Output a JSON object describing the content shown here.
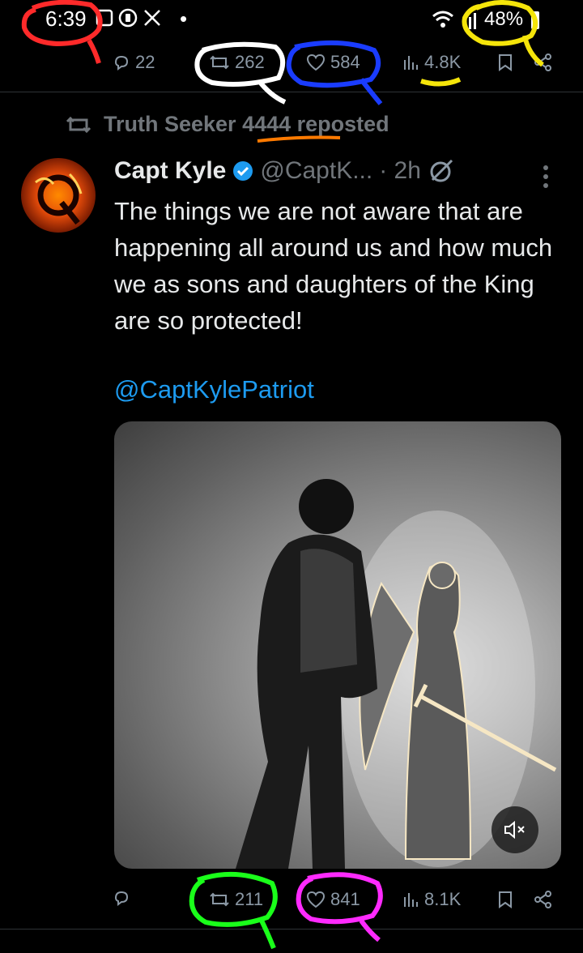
{
  "status_bar": {
    "time": "6:39",
    "notification_dot": "•",
    "battery": "48%"
  },
  "top_actions": {
    "replies": "22",
    "reposts": "262",
    "likes": "584",
    "views": "4.8K"
  },
  "repost_header": {
    "text": "Truth Seeker 4444 reposted"
  },
  "tweet": {
    "author_name": "Capt Kyle",
    "handle": "@CaptK...",
    "time": "· 2h",
    "text": "The things we are not aware that are happening all around us and how much we as sons and daughters of the King are so protected!",
    "mention": "@CaptKylePatriot"
  },
  "bottom_actions": {
    "replies": "",
    "reposts": "211",
    "likes": "841",
    "views": "8.1K"
  },
  "annotation_colors": {
    "time_circle": "#ff2a2a",
    "battery_circle": "#f5e50a",
    "repost_circle": "#ffffff",
    "like_circle": "#1a3cff",
    "views_underline": "#f5e50a",
    "username_underline": "#ff7a00",
    "bottom_repost_circle": "#1aff1a",
    "bottom_like_circle": "#ff2aff"
  },
  "icons": [
    "notification-icon",
    "x-logo-icon",
    "wifi-icon",
    "battery-icon",
    "reply-icon",
    "repost-icon",
    "like-icon",
    "views-icon",
    "bookmark-icon",
    "share-icon",
    "verified-icon",
    "grok-icon",
    "more-icon",
    "mute-icon"
  ]
}
